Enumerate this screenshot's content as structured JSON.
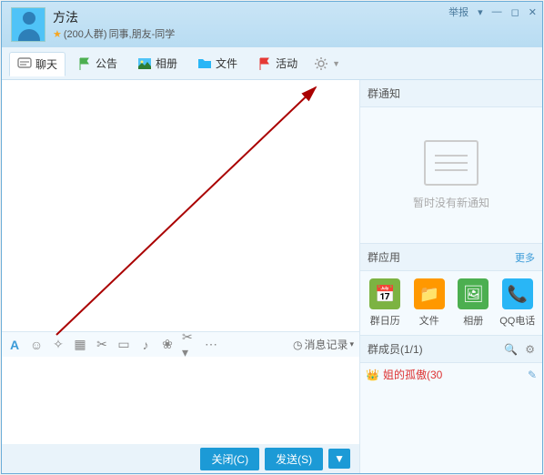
{
  "header": {
    "group_name": "方法",
    "member_count_text": "(200人群)",
    "tags": "同事,朋友-同学",
    "report": "举报",
    "dropdown": "▾"
  },
  "tabs": {
    "chat": "聊天",
    "notice": "公告",
    "album": "相册",
    "file": "文件",
    "activity": "活动"
  },
  "editor": {
    "msg_record": "消息记录",
    "close_btn": "关闭(C)",
    "send_btn": "发送(S)"
  },
  "right": {
    "notify_title": "群通知",
    "notify_empty": "暂时没有新通知",
    "apps_title": "群应用",
    "apps_more": "更多",
    "app_calendar": "群日历",
    "app_file": "文件",
    "app_album": "相册",
    "app_qqcall": "QQ电话",
    "members_title": "群成员(1/1)",
    "member1": "姐的孤傲(30"
  }
}
